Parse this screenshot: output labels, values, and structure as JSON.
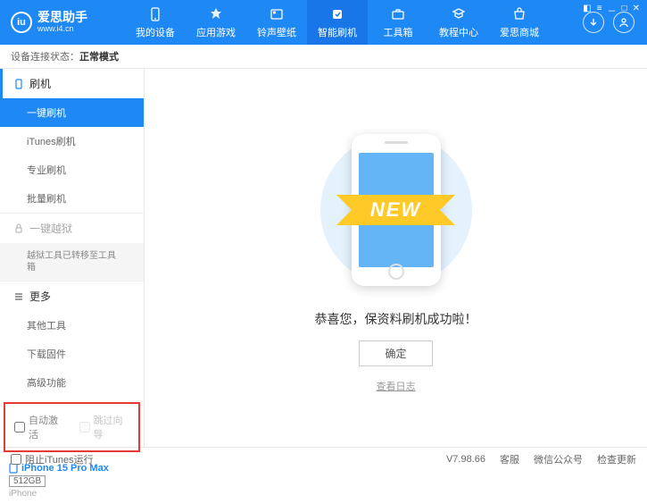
{
  "header": {
    "app_name": "爱思助手",
    "app_url": "www.i4.cn",
    "nav": [
      {
        "label": "我的设备"
      },
      {
        "label": "应用游戏"
      },
      {
        "label": "铃声壁纸"
      },
      {
        "label": "智能刷机"
      },
      {
        "label": "工具箱"
      },
      {
        "label": "教程中心"
      },
      {
        "label": "爱思商城"
      }
    ]
  },
  "status": {
    "label": "设备连接状态：",
    "value": "正常模式"
  },
  "sidebar": {
    "group_flash": "刷机",
    "items_flash": [
      "一键刷机",
      "iTunes刷机",
      "专业刷机",
      "批量刷机"
    ],
    "group_jailbreak": "一键越狱",
    "jailbreak_sub": "越狱工具已转移至工具箱",
    "group_more": "更多",
    "items_more": [
      "其他工具",
      "下载固件",
      "高级功能"
    ],
    "cb_auto_activate": "自动激活",
    "cb_skip_guide": "跳过向导",
    "device_name": "iPhone 15 Pro Max",
    "storage": "512GB",
    "device_type": "iPhone"
  },
  "content": {
    "banner": "NEW",
    "success": "恭喜您，保资料刷机成功啦！",
    "ok": "确定",
    "view_log": "查看日志"
  },
  "footer": {
    "block_itunes": "阻止iTunes运行",
    "version": "V7.98.66",
    "links": [
      "客服",
      "微信公众号",
      "检查更新"
    ]
  }
}
